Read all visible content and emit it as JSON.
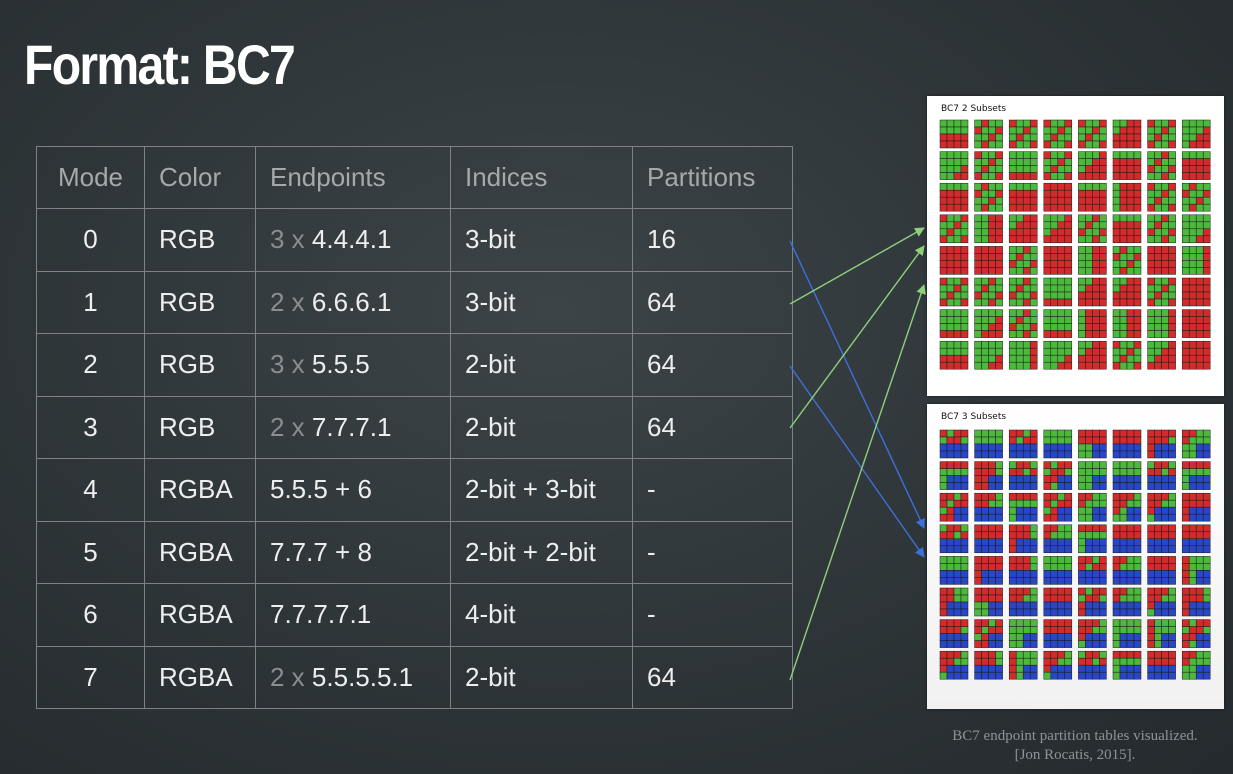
{
  "slide": {
    "title": "Format: BC7",
    "caption_line1": "BC7 endpoint partition tables visualized.",
    "caption_line2": "[Jon Rocatis, 2015]."
  },
  "table": {
    "headers": [
      "Mode",
      "Color",
      "Endpoints",
      "Indices",
      "Partitions"
    ],
    "rows": [
      {
        "mode": "0",
        "color": "RGB",
        "ep_prefix": "3 x ",
        "ep_main": "4.4.4.1",
        "indices": "3-bit",
        "partitions": "16"
      },
      {
        "mode": "1",
        "color": "RGB",
        "ep_prefix": "2 x ",
        "ep_main": "6.6.6.1",
        "indices": "3-bit",
        "partitions": "64"
      },
      {
        "mode": "2",
        "color": "RGB",
        "ep_prefix": "3 x ",
        "ep_main": "5.5.5",
        "indices": "2-bit",
        "partitions": "64"
      },
      {
        "mode": "3",
        "color": "RGB",
        "ep_prefix": "2 x ",
        "ep_main": "7.7.7.1",
        "indices": "2-bit",
        "partitions": "64"
      },
      {
        "mode": "4",
        "color": "RGBA",
        "ep_prefix": "",
        "ep_main": "5.5.5 + 6",
        "indices": "2-bit + 3-bit",
        "partitions": "-"
      },
      {
        "mode": "5",
        "color": "RGBA",
        "ep_prefix": "",
        "ep_main": "7.7.7 + 8",
        "indices": "2-bit + 2-bit",
        "partitions": "-"
      },
      {
        "mode": "6",
        "color": "RGBA",
        "ep_prefix": "",
        "ep_main": "7.7.7.7.1",
        "indices": "4-bit",
        "partitions": "-"
      },
      {
        "mode": "7",
        "color": "RGBA",
        "ep_prefix": "2 x ",
        "ep_main": "5.5.5.5.1",
        "indices": "2-bit",
        "partitions": "64"
      }
    ]
  },
  "panels": {
    "two_subsets": {
      "label": "BC7 2 Subsets"
    },
    "three_subsets": {
      "label": "BC7 3 Subsets"
    }
  },
  "colors": {
    "red": "#d22b2b",
    "green": "#4cb83c",
    "blue": "#2846c8",
    "arrow_blue": "#3f6fd8",
    "arrow_green": "#8ed07a"
  }
}
